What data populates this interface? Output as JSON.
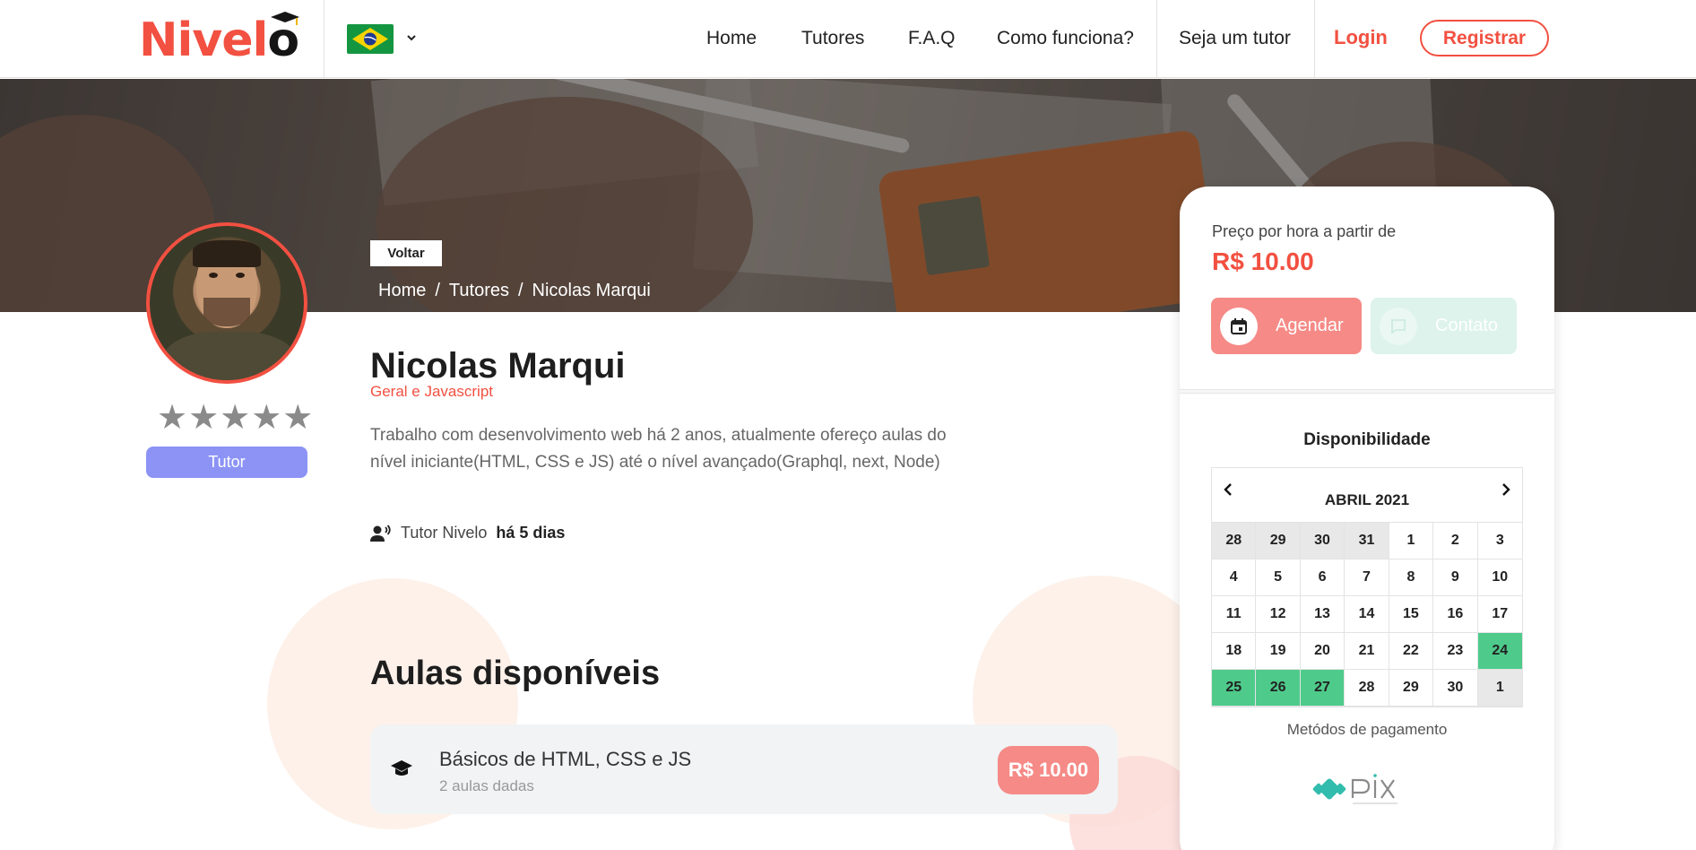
{
  "header": {
    "logo_text": "Nivel",
    "logo_o": "o",
    "nav": [
      "Home",
      "Tutores",
      "F.A.Q",
      "Como funciona?",
      "Seja um tutor"
    ],
    "login": "Login",
    "register": "Registrar",
    "language_flag": "brazil-flag-icon"
  },
  "hero": {
    "back_button": "Voltar",
    "breadcrumb": [
      "Home",
      "/",
      "Tutores",
      "/",
      "Nicolas Marqui"
    ]
  },
  "profile": {
    "stars": "★★★★★",
    "role_badge": "Tutor",
    "name": "Nicolas Marqui",
    "subject": "Geral e Javascript",
    "bio": "Trabalho com desenvolvimento web há 2 anos, atualmente ofereço aulas do nível iniciante(HTML, CSS e JS) até o nível avançado(Graphql, next, Node)",
    "since_label": "Tutor Nivelo",
    "since_value": "há 5 dias"
  },
  "classes": {
    "title": "Aulas disponíveis",
    "items": [
      {
        "title": "Básicos de HTML, CSS e JS",
        "subtitle": "2 aulas dadas",
        "price": "R$ 10.00"
      }
    ]
  },
  "booking": {
    "price_label": "Preço por hora a partir de",
    "price": "R$ 10.00",
    "schedule_button": "Agendar",
    "contact_button": "Contato",
    "availability_title": "Disponibilidade",
    "payment_methods": "Metódos de pagamento",
    "calendar": {
      "month": "ABRIL 2021",
      "days": [
        {
          "d": "28",
          "s": "out"
        },
        {
          "d": "29",
          "s": "out"
        },
        {
          "d": "30",
          "s": "out"
        },
        {
          "d": "31",
          "s": "out"
        },
        {
          "d": "1",
          "s": ""
        },
        {
          "d": "2",
          "s": ""
        },
        {
          "d": "3",
          "s": ""
        },
        {
          "d": "4",
          "s": ""
        },
        {
          "d": "5",
          "s": ""
        },
        {
          "d": "6",
          "s": ""
        },
        {
          "d": "7",
          "s": ""
        },
        {
          "d": "8",
          "s": ""
        },
        {
          "d": "9",
          "s": ""
        },
        {
          "d": "10",
          "s": ""
        },
        {
          "d": "11",
          "s": ""
        },
        {
          "d": "12",
          "s": ""
        },
        {
          "d": "13",
          "s": ""
        },
        {
          "d": "14",
          "s": ""
        },
        {
          "d": "15",
          "s": ""
        },
        {
          "d": "16",
          "s": ""
        },
        {
          "d": "17",
          "s": ""
        },
        {
          "d": "18",
          "s": ""
        },
        {
          "d": "19",
          "s": ""
        },
        {
          "d": "20",
          "s": ""
        },
        {
          "d": "21",
          "s": ""
        },
        {
          "d": "22",
          "s": ""
        },
        {
          "d": "23",
          "s": ""
        },
        {
          "d": "24",
          "s": "avail"
        },
        {
          "d": "25",
          "s": "avail"
        },
        {
          "d": "26",
          "s": "avail"
        },
        {
          "d": "27",
          "s": "avail"
        },
        {
          "d": "28",
          "s": ""
        },
        {
          "d": "29",
          "s": ""
        },
        {
          "d": "30",
          "s": ""
        },
        {
          "d": "1",
          "s": "out"
        }
      ]
    },
    "payment_logo": "pix-logo"
  },
  "colors": {
    "brand": "#f25041",
    "available": "#4ecb8b",
    "tutor_badge": "#8c93f5",
    "price_pill": "#f58a86"
  }
}
